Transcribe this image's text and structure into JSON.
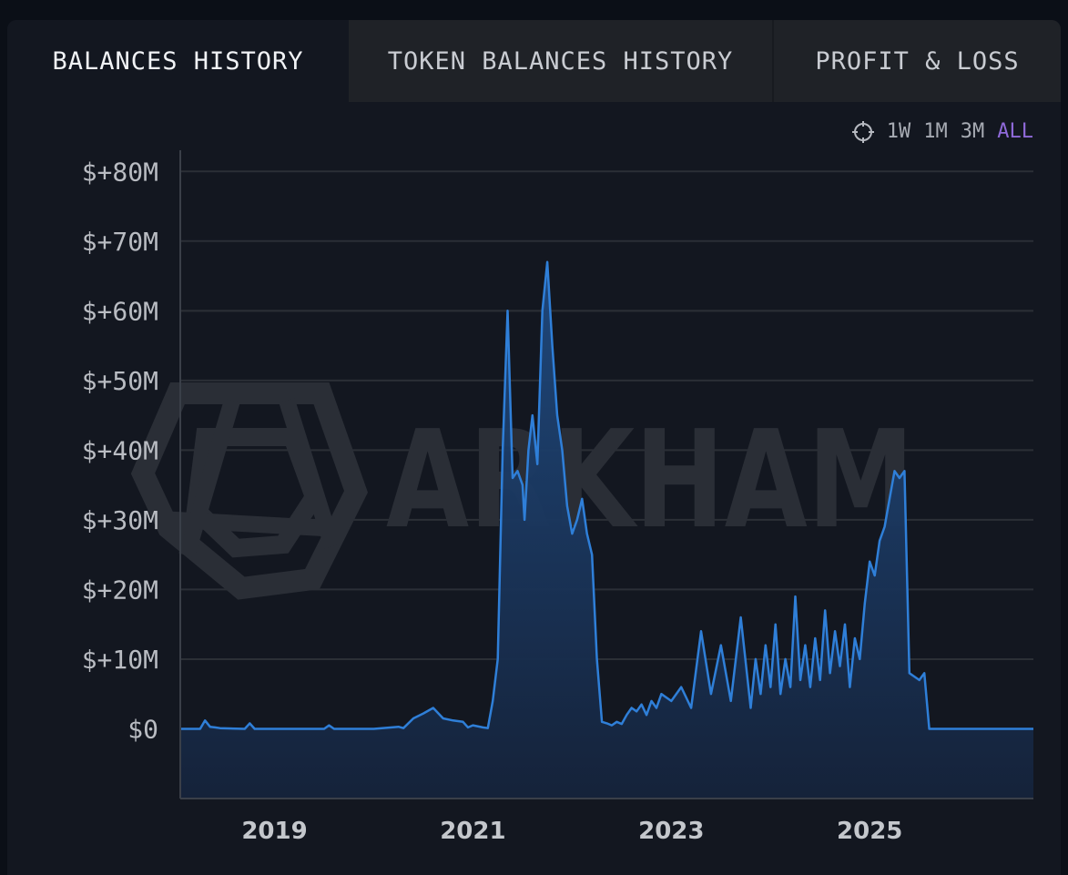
{
  "tabs": [
    {
      "label": "BALANCES HISTORY",
      "active": true
    },
    {
      "label": "TOKEN BALANCES HISTORY",
      "active": false
    },
    {
      "label": "PROFIT & LOSS",
      "active": false
    }
  ],
  "range": {
    "icon": "crosshair-icon",
    "options": [
      "1W",
      "1M",
      "3M",
      "ALL"
    ],
    "selected": "ALL"
  },
  "watermark": {
    "text": "ARKHAM"
  },
  "colors": {
    "background": "#131720",
    "line": "#2f7fd8",
    "area": "#1b3b66",
    "grid": "#2b2f36",
    "selected_range": "#8f6ad9"
  },
  "chart_data": {
    "type": "area",
    "title": "",
    "xlabel": "",
    "ylabel": "",
    "y_tick_labels": [
      "$0",
      "$+10M",
      "$+20M",
      "$+30M",
      "$+40M",
      "$+50M",
      "$+60M",
      "$+70M",
      "$+80M"
    ],
    "y_ticks": [
      0,
      10,
      20,
      30,
      40,
      50,
      60,
      70,
      80
    ],
    "x_tick_labels": [
      "2019",
      "2021",
      "2023",
      "2025"
    ],
    "x_ticks": [
      2019,
      2021,
      2023,
      2025
    ],
    "xlim": [
      2018.05,
      2026.65
    ],
    "ylim": [
      -10,
      85
    ],
    "grid": true,
    "series": [
      {
        "unit": "USD millions",
        "x": [
          2018.05,
          2018.25,
          2018.3,
          2018.35,
          2018.4,
          2018.45,
          2018.7,
          2018.75,
          2018.8,
          2019.5,
          2019.55,
          2019.6,
          2020.0,
          2020.25,
          2020.3,
          2020.4,
          2020.5,
          2020.6,
          2020.7,
          2020.8,
          2020.9,
          2020.95,
          2021.0,
          2021.1,
          2021.15,
          2021.2,
          2021.25,
          2021.3,
          2021.35,
          2021.4,
          2021.45,
          2021.5,
          2021.52,
          2021.56,
          2021.6,
          2021.65,
          2021.7,
          2021.75,
          2021.8,
          2021.85,
          2021.9,
          2021.95,
          2022.0,
          2022.05,
          2022.1,
          2022.15,
          2022.2,
          2022.25,
          2022.3,
          2022.35,
          2022.4,
          2022.45,
          2022.5,
          2022.55,
          2022.6,
          2022.65,
          2022.7,
          2022.75,
          2022.8,
          2022.85,
          2022.9,
          2023.0,
          2023.1,
          2023.2,
          2023.3,
          2023.4,
          2023.5,
          2023.6,
          2023.7,
          2023.8,
          2023.85,
          2023.9,
          2023.95,
          2024.0,
          2024.05,
          2024.1,
          2024.15,
          2024.2,
          2024.25,
          2024.3,
          2024.35,
          2024.4,
          2024.45,
          2024.5,
          2024.55,
          2024.6,
          2024.65,
          2024.7,
          2024.75,
          2024.8,
          2024.85,
          2024.9,
          2024.95,
          2025.0,
          2025.05,
          2025.1,
          2025.15,
          2025.2,
          2025.25,
          2025.3,
          2025.35,
          2025.4,
          2025.45,
          2025.5,
          2025.55,
          2025.6,
          2025.65,
          2025.7,
          2025.75,
          2025.78,
          2025.8,
          2025.85,
          2025.9,
          2026.0,
          2026.3,
          2026.65
        ],
        "y": [
          0,
          0,
          1.2,
          0.3,
          0.2,
          0.1,
          0,
          0.8,
          0,
          0,
          0.5,
          0,
          0,
          0.3,
          0.1,
          1.5,
          2.2,
          3,
          1.5,
          1.2,
          1,
          0.2,
          0.5,
          0.2,
          0.1,
          4,
          10,
          40,
          60,
          36,
          37,
          35,
          30,
          40,
          45,
          38,
          60,
          67,
          55,
          45,
          40,
          32,
          28,
          30,
          33,
          28,
          25,
          10,
          1,
          0.8,
          0.5,
          1,
          0.7,
          2,
          3,
          2.5,
          3.5,
          2,
          4,
          3,
          5,
          4,
          6,
          3,
          14,
          5,
          12,
          4,
          16,
          3,
          10,
          5,
          12,
          6,
          15,
          5,
          10,
          6,
          19,
          7,
          12,
          6,
          13,
          7,
          17,
          8,
          14,
          9,
          15,
          6,
          13,
          10,
          18,
          24,
          22,
          27,
          29,
          33,
          37,
          36,
          37,
          8,
          7.5,
          7,
          8,
          0,
          0,
          0,
          0,
          0,
          0,
          0,
          0,
          0,
          0,
          0
        ]
      }
    ]
  }
}
